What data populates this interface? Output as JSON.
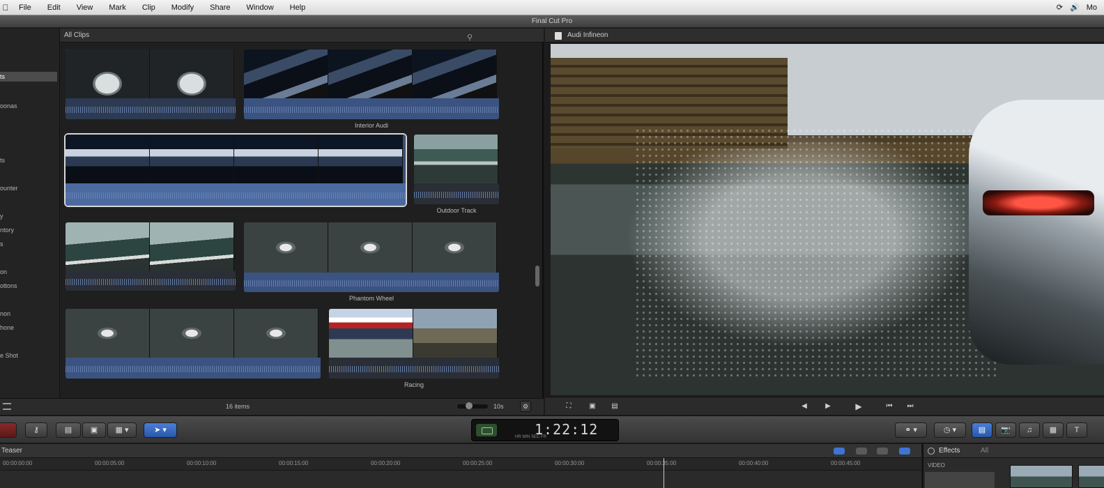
{
  "menubar": {
    "items": [
      "File",
      "Edit",
      "View",
      "Mark",
      "Clip",
      "Modify",
      "Share",
      "Window",
      "Help"
    ],
    "right_text": "Mo"
  },
  "window": {
    "title": "Final Cut Pro"
  },
  "sidebar": {
    "items": [
      "ts",
      "oonas",
      "ts",
      "ounter",
      "y",
      "ntory",
      "s",
      "on",
      "ottons",
      "non",
      "hone",
      "e Shot"
    ],
    "selected_index": 0
  },
  "browser": {
    "header": "All Clips",
    "footer_count": "16 items",
    "footer_duration": "10s",
    "clips": [
      {
        "name": "",
        "look": "f-studio"
      },
      {
        "name": "Interior Audi",
        "look": "f-interior"
      },
      {
        "name": "",
        "look": "f-shift"
      },
      {
        "name": "Outdoor Track",
        "look": "f-track"
      },
      {
        "name": "",
        "look": "f-sky"
      },
      {
        "name": "Phantom Wheel",
        "look": "f-road"
      },
      {
        "name": "",
        "look": "f-road"
      },
      {
        "name": "Racing",
        "look": "f-race"
      }
    ]
  },
  "viewer": {
    "title": "Audi Infineon"
  },
  "toolbar": {
    "timecode": "1:22:12",
    "timecode_sub": "HR  MIN  SEC  FR"
  },
  "timeline": {
    "title": "Teaser",
    "ruler": [
      "00:00:00:00",
      "00:00:05:00",
      "00:00:10:00",
      "00:00:15:00",
      "00:00:20:00",
      "00:00:25:00",
      "00:00:30:00",
      "00:00:35:00",
      "00:00:40:00",
      "00:00:45:00"
    ],
    "playhead_fraction": 0.72
  },
  "effects": {
    "title": "Effects",
    "toggle": "All",
    "category": "VIDEO"
  },
  "colors": {
    "accent_blue": "#3f74d0",
    "selection_blue": "#2a56a8",
    "panel_bg": "#1f1f1f"
  }
}
